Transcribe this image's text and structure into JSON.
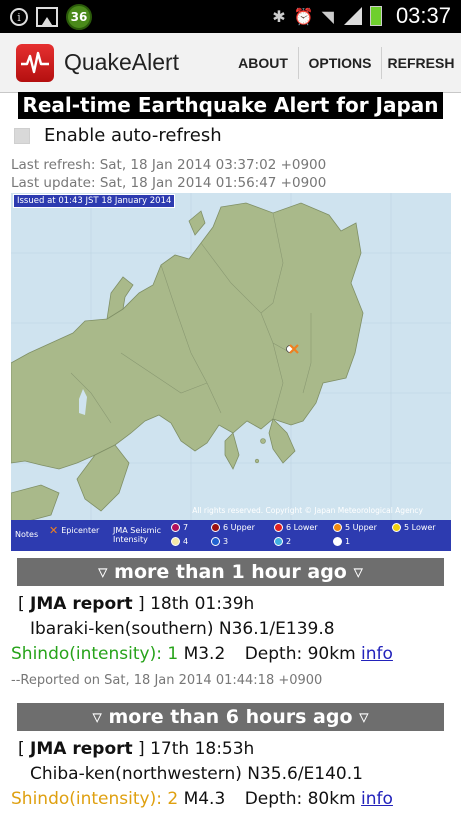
{
  "status_bar": {
    "badge": "36",
    "time": "03:37",
    "info_icon": "i"
  },
  "app": {
    "title": "QuakeAlert",
    "menu": [
      "ABOUT",
      "OPTIONS",
      "REFRESH"
    ]
  },
  "page": {
    "title": "Real-time Earthquake Alert for Japan",
    "auto_refresh_label": "Enable auto-refresh",
    "last_refresh": "Last refresh: Sat, 18 Jan 2014 03:37:02 +0900",
    "last_update": "Last update: Sat, 18 Jan 2014 01:56:47 +0900"
  },
  "map": {
    "issued": "Issued at 01:43 JST 18 January 2014",
    "rights": "All rights reserved. Copyright © Japan Meteorological Agency",
    "legend": {
      "notes": "Notes",
      "epicenter": "Epicenter",
      "intensity_label_1": "JMA Seismic",
      "intensity_label_2": "Intensity",
      "levels": [
        "7",
        "6 Upper",
        "6 Lower",
        "5 Upper",
        "5 Lower",
        "4",
        "3",
        "2",
        "1"
      ]
    },
    "colors": {
      "sea": "#cfe3ef",
      "land": "#a9b98a",
      "epicenter": "#f08020",
      "legend_bg": "#2d3bb0",
      "level_7": "#b0105a",
      "level_6u": "#9a1010",
      "level_6l": "#e02020",
      "level_5u": "#f08a10",
      "level_5l": "#f0d010",
      "level_4": "#f3e7a8",
      "level_3": "#2060d0",
      "level_2": "#40b0e0",
      "level_1": "#ffffff"
    }
  },
  "sections": [
    {
      "header": "▿ more than 1 hour ago ▿",
      "reports": [
        {
          "open_bracket": "[",
          "source": "JMA report",
          "close_bracket": "]",
          "datetime": "18th 01:39h",
          "location": "Ibaraki-ken(southern) N36.1/E139.8",
          "shindo": "Shindo(intensity): 1",
          "magnitude": "M3.2",
          "depth": "Depth: 90km",
          "info_link": "info",
          "reported": "--Reported on Sat, 18 Jan 2014 01:44:18 +0900"
        }
      ]
    },
    {
      "header": "▿ more than 6 hours ago ▿",
      "reports": [
        {
          "open_bracket": "[",
          "source": "JMA report",
          "close_bracket": "]",
          "datetime": "17th 18:53h",
          "location": "Chiba-ken(northwestern) N35.6/E140.1",
          "shindo": "Shindo(intensity): 2",
          "magnitude": "M4.3",
          "depth": "Depth: 80km",
          "info_link": "info"
        }
      ]
    }
  ]
}
